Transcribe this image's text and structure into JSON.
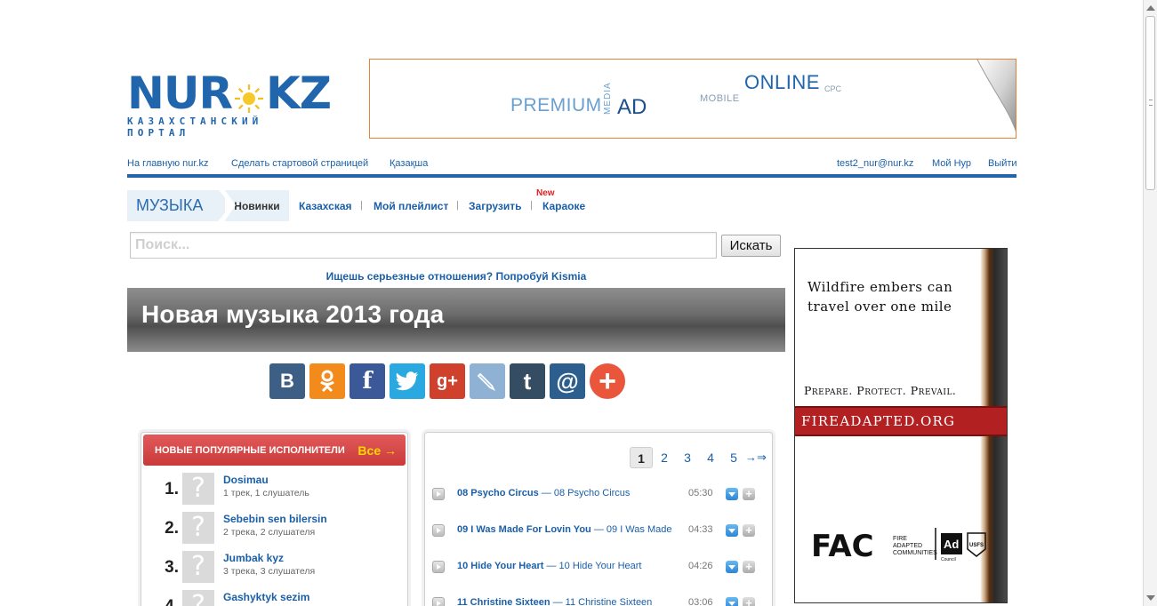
{
  "logo": {
    "left": "NUR",
    "right": "KZ",
    "tagline": "КАЗАХСТАНСКИЙ ПОРТАЛ"
  },
  "banner": {
    "premium": "PREMIUM",
    "media": "MEDIA",
    "ad": "AD",
    "mobile": "MOBILE",
    "online": "ONLINE",
    "cpc": "CPC"
  },
  "topnav": {
    "home": "На главную nur.kz",
    "start_page": "Сделать стартовой страницей",
    "kazakh": "Қазақша",
    "email": "test2_nur@nur.kz",
    "my_nur": "Мой Нур",
    "logout": "Выйти"
  },
  "section": {
    "label": "МУЗЫКА",
    "tabs": [
      "Новинки",
      "Казахская",
      "Мой плейлист",
      "Загрузить",
      "Караоке"
    ],
    "new_badge": "New",
    "separator": "|"
  },
  "search": {
    "placeholder": "Поиск...",
    "button": "Искать"
  },
  "promo": "Ищешь серьезные отношения? Попробуй Kismia",
  "page_title": "Новая музыка 2013 года",
  "share": {
    "vk": "В",
    "ok": "ok",
    "fb": "f",
    "tw": "t",
    "gp": "g+",
    "lj": "lj",
    "tumblr": "t",
    "mail": "@",
    "more": "+",
    "colors": {
      "vk": "#3d5f86",
      "ok": "#f28a1c",
      "fb": "#3b5998",
      "tw": "#2aa9e0",
      "gp": "#d0412d",
      "lj": "#8fb2d4",
      "tumblr": "#354d62",
      "mail": "#2d5f8e",
      "more": "#e9563b"
    }
  },
  "artists": {
    "title": "НОВЫЕ ПОПУЛЯРНЫЕ ИСПОЛНИТЕЛИ",
    "all": "Все →",
    "items": [
      {
        "num": "1.",
        "name": "Dosimau",
        "meta": "1 трек, 1 слушатель",
        "pic": "?"
      },
      {
        "num": "2.",
        "name": "Sebebin sen bilersin",
        "meta": "2 трека, 2 слушателя",
        "pic": "?"
      },
      {
        "num": "3.",
        "name": "Jumbak kyz",
        "meta": "3 трека, 3 слушателя",
        "pic": "?"
      },
      {
        "num": "4.",
        "name": "Gashyktyk sezim",
        "meta": "",
        "pic": "?"
      }
    ]
  },
  "pager": {
    "pages": [
      "1",
      "2",
      "3",
      "4",
      "5"
    ],
    "next": "→⇒",
    "current": "1"
  },
  "tracks": [
    {
      "title": "08 Psycho Circus",
      "album": "— 08 Psycho Circus",
      "duration": "05:30"
    },
    {
      "title": "09 I Was Made For Lovin You",
      "album": "— 09 I Was Made",
      "duration": "04:33"
    },
    {
      "title": "10 Hide Your Heart",
      "album": "— 10 Hide Your Heart",
      "duration": "04:26"
    },
    {
      "title": "11 Christine Sixteen",
      "album": "— 11 Christine Sixteen",
      "duration": "03:06"
    }
  ],
  "sidead": {
    "line1": "Wildfire embers can",
    "line2": "travel over one mile",
    "slogan": "Prepare. Protect. Prevail.",
    "url": "FIREADAPTED.ORG",
    "org_mark": "FAC",
    "org_line1": "FIRE",
    "org_line2": "ADAPTED",
    "org_line3": "COMMUNITIES",
    "ad_mark": "Ad",
    "ad_council": "Council",
    "usfs": "USFS"
  }
}
